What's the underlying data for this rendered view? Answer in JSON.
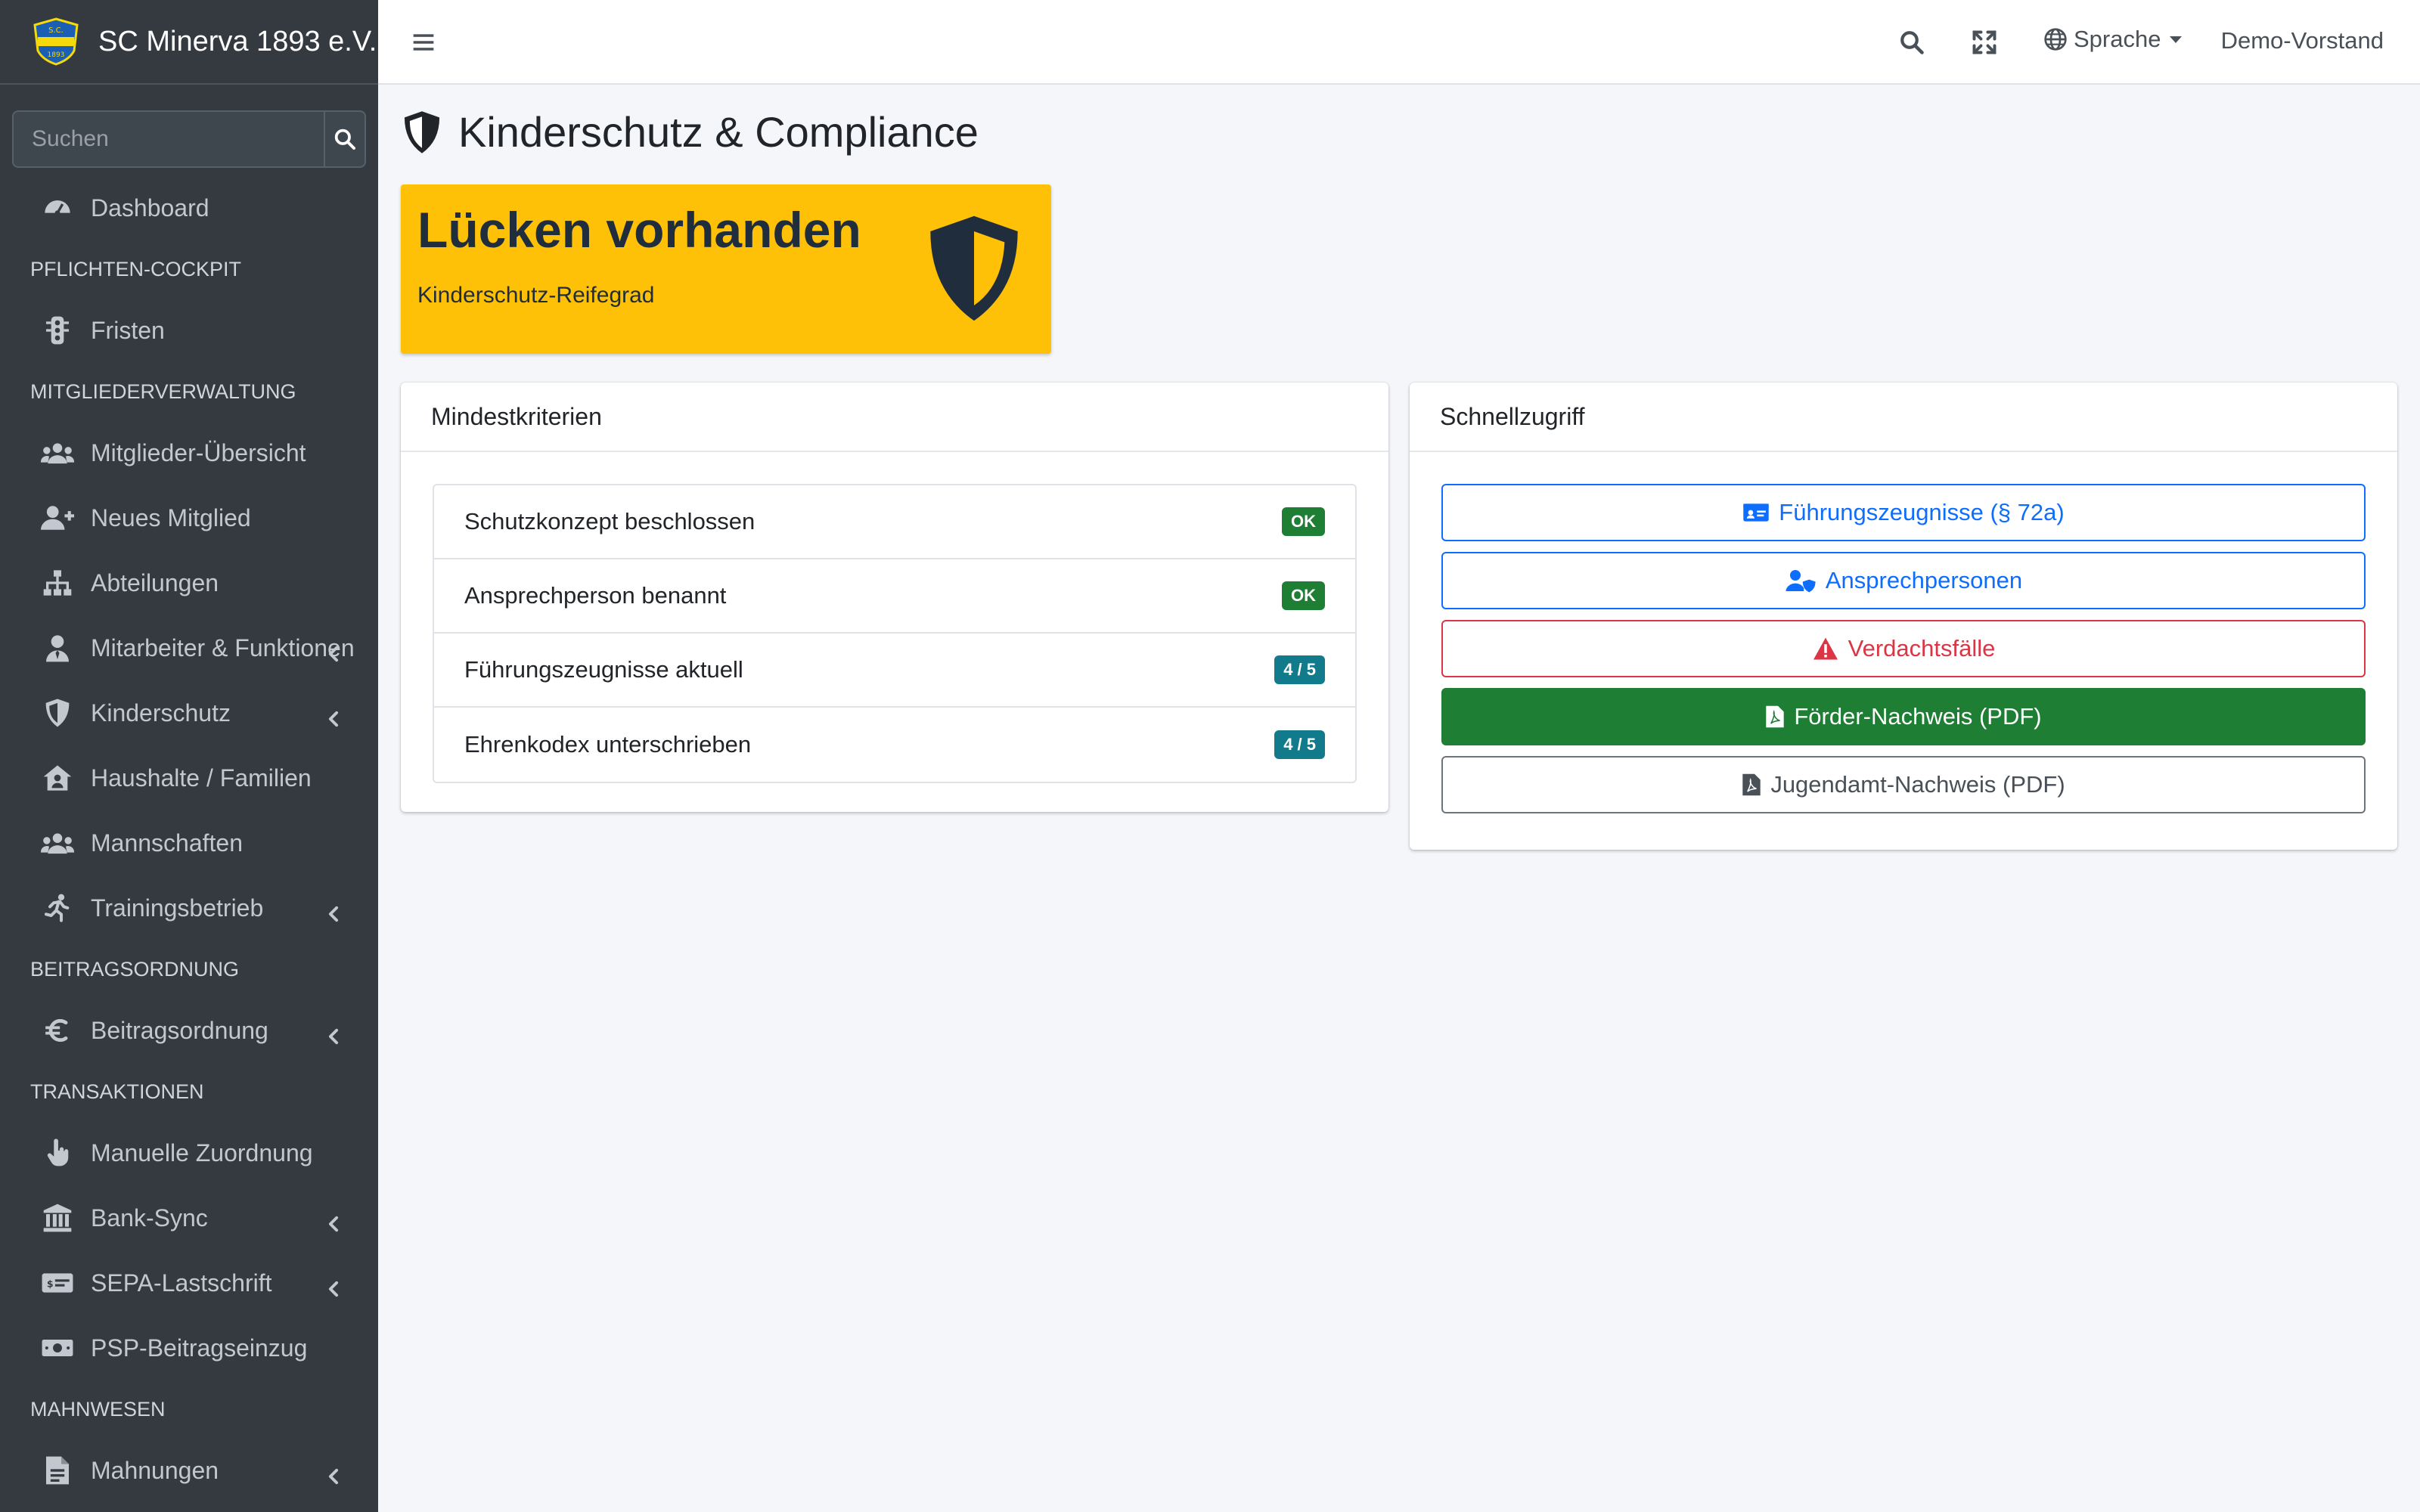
{
  "brand": {
    "name": "SC Minerva 1893 e.V."
  },
  "search": {
    "placeholder": "Suchen"
  },
  "sidebar": {
    "items": [
      {
        "type": "item",
        "label": "Dashboard",
        "icon": "tachometer-icon",
        "chevron": false
      },
      {
        "type": "header",
        "label": "PFLICHTEN-COCKPIT"
      },
      {
        "type": "item",
        "label": "Fristen",
        "icon": "traffic-light-icon",
        "chevron": false
      },
      {
        "type": "header",
        "label": "MITGLIEDERVERWALTUNG"
      },
      {
        "type": "item",
        "label": "Mitglieder-Übersicht",
        "icon": "users-icon",
        "chevron": false
      },
      {
        "type": "item",
        "label": "Neues Mitglied",
        "icon": "user-plus-icon",
        "chevron": false
      },
      {
        "type": "item",
        "label": "Abteilungen",
        "icon": "sitemap-icon",
        "chevron": false
      },
      {
        "type": "item",
        "label": "Mitarbeiter & Funktionen",
        "icon": "user-tie-icon",
        "chevron": true
      },
      {
        "type": "item",
        "label": "Kinderschutz",
        "icon": "shield-icon",
        "chevron": true
      },
      {
        "type": "item",
        "label": "Haushalte / Familien",
        "icon": "house-user-icon",
        "chevron": false
      },
      {
        "type": "item",
        "label": "Mannschaften",
        "icon": "users-icon",
        "chevron": false
      },
      {
        "type": "item",
        "label": "Trainingsbetrieb",
        "icon": "running-icon",
        "chevron": true
      },
      {
        "type": "header",
        "label": "BEITRAGSORDNUNG"
      },
      {
        "type": "item",
        "label": "Beitragsordnung",
        "icon": "euro-icon",
        "chevron": true
      },
      {
        "type": "header",
        "label": "TRANSAKTIONEN"
      },
      {
        "type": "item",
        "label": "Manuelle Zuordnung",
        "icon": "hand-pointer-icon",
        "chevron": false
      },
      {
        "type": "item",
        "label": "Bank-Sync",
        "icon": "bank-icon",
        "chevron": true
      },
      {
        "type": "item",
        "label": "SEPA-Lastschrift",
        "icon": "money-check-icon",
        "chevron": true
      },
      {
        "type": "item",
        "label": "PSP-Beitragseinzug",
        "icon": "money-bill-icon",
        "chevron": false
      },
      {
        "type": "header",
        "label": "MAHNWESEN"
      },
      {
        "type": "item",
        "label": "Mahnungen",
        "icon": "file-alt-icon",
        "chevron": true
      }
    ]
  },
  "topbar": {
    "language": "Sprache",
    "user": "Demo-Vorstand"
  },
  "page": {
    "title": "Kinderschutz & Compliance"
  },
  "status": {
    "headline": "Lücken vorhanden",
    "subtitle": "Kinderschutz-Reifegrad"
  },
  "criteria": {
    "title": "Mindestkriterien",
    "rows": [
      {
        "label": "Schutzkonzept beschlossen",
        "badge": "OK",
        "badge_color": "#1e7e34"
      },
      {
        "label": "Ansprechperson benannt",
        "badge": "OK",
        "badge_color": "#1e7e34"
      },
      {
        "label": "Führungszeugnisse aktuell",
        "badge": "4 / 5",
        "badge_color": "#117a8b"
      },
      {
        "label": "Ehrenkodex unterschrieben",
        "badge": "4 / 5",
        "badge_color": "#117a8b"
      }
    ]
  },
  "quick": {
    "title": "Schnellzugriff",
    "buttons": [
      {
        "label": "Führungszeugnisse (§ 72a)",
        "icon": "id-card-icon",
        "style": "outline-primary"
      },
      {
        "label": "Ansprechpersonen",
        "icon": "user-shield-icon",
        "style": "outline-primary"
      },
      {
        "label": "Verdachtsfälle",
        "icon": "warning-icon",
        "style": "outline-danger"
      },
      {
        "label": "Förder-Nachweis (PDF)",
        "icon": "file-pdf-icon",
        "style": "success"
      },
      {
        "label": "Jugendamt-Nachweis (PDF)",
        "icon": "file-pdf-icon",
        "style": "outline-secondary"
      }
    ]
  },
  "colors": {
    "sidebar_bg": "#343a40",
    "warning": "#ffc107",
    "primary": "#0d6efd",
    "danger": "#dc3545",
    "success": "#1e7e34"
  }
}
